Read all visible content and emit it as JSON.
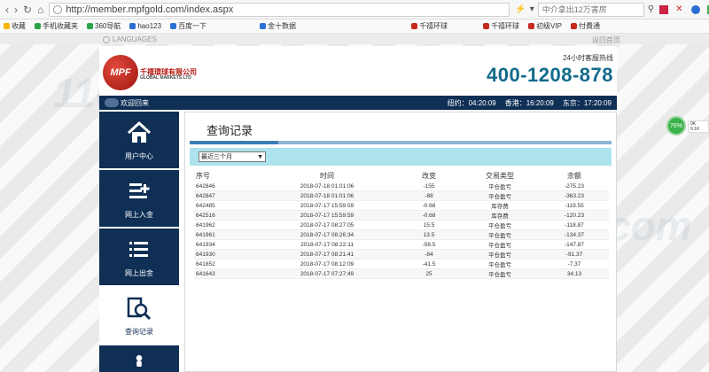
{
  "browser": {
    "url": "http://member.mpfgold.com/index.aspx",
    "search_placeholder": "中介拿出12万害房",
    "bookmarks": [
      "收藏",
      "手机收藏夹",
      "360导航",
      "hao123",
      "百度一下",
      "金十数据",
      "千禧环球",
      "千禧环球",
      "初级VIP",
      "付費通"
    ]
  },
  "page": {
    "language_label": "LANGUAGES",
    "home_label": "返回首页",
    "logo_mark": "MPF",
    "logo_cn": "千禧環球有限公司",
    "logo_en": "GLOBAL MARKETS LTD",
    "hotline_label": "24小时客服热线",
    "hotline": "400-1208-878",
    "welcome": "欢迎回来",
    "clocks": [
      "纽约：04:20:09",
      "香港：16:20:09",
      "东京：17:20:09"
    ]
  },
  "sidebar": {
    "items": [
      {
        "label": "用户中心",
        "icon": "home-icon"
      },
      {
        "label": "网上入金",
        "icon": "deposit-icon"
      },
      {
        "label": "网上出金",
        "icon": "withdraw-icon"
      },
      {
        "label": "查询记录",
        "icon": "search-records-icon"
      },
      {
        "label": "",
        "icon": "user-icon"
      }
    ]
  },
  "main": {
    "title": "查询记录",
    "filter_value": "最近三个月",
    "columns": [
      "序号",
      "时间",
      "改变",
      "交易类型",
      "余额"
    ],
    "rows": [
      [
        "642846",
        "2018-07-18 01:01:06",
        "-155",
        "平仓盈亏",
        "-275.23"
      ],
      [
        "642847",
        "2018-07-18 01:01:06",
        "-88",
        "平仓盈亏",
        "-363.23"
      ],
      [
        "642485",
        "2018-07-17 15:59:59",
        "-0.68",
        "库存费",
        "-119.55"
      ],
      [
        "642516",
        "2018-07-17 15:59:59",
        "-0.68",
        "库存费",
        "-120.23"
      ],
      [
        "641962",
        "2018-07-17 08:27:05",
        "15.5",
        "平仓盈亏",
        "-118.87"
      ],
      [
        "641961",
        "2018-07-17 08:26:34",
        "13.5",
        "平仓盈亏",
        "-134.37"
      ],
      [
        "641934",
        "2018-07-17 08:22:11",
        "-56.5",
        "平仓盈亏",
        "-147.87"
      ],
      [
        "641930",
        "2018-07-17 08:21:41",
        "-84",
        "平仓盈亏",
        "-91.37"
      ],
      [
        "641852",
        "2018-07-17 08:12:09",
        "-41.5",
        "平仓盈亏",
        "-7.37"
      ],
      [
        "641643",
        "2018-07-17 07:27:49",
        "25",
        "平仓盈亏",
        "34.13"
      ]
    ]
  },
  "overlay": {
    "percent": "76%",
    "lines": [
      "0K",
      "0.1K"
    ]
  },
  "watermark": "110.com"
}
